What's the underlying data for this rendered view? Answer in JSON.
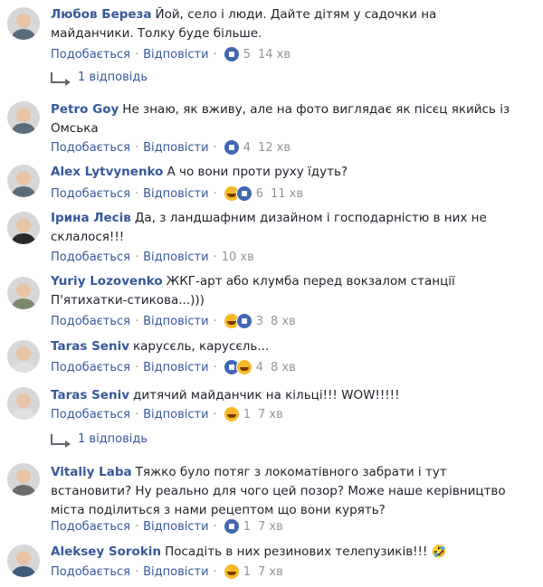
{
  "labels": {
    "like": "Подобається",
    "reply": "Відповісти",
    "separator": "·"
  },
  "comments": [
    {
      "author": "Любов Береза",
      "text": "Йой, село і люди. Дайте дітям у садочки на майданчики. Толку буде більше.",
      "reactions": [
        "like-icon"
      ],
      "count": "5",
      "time": "14 хв",
      "replies": "1 відповідь"
    },
    {
      "author": "Petro Goy",
      "text": "Не знаю, як вживу, але на фото виглядає як пісєц якийсь із Омська",
      "reactions": [
        "like-icon"
      ],
      "count": "4",
      "time": "12 хв"
    },
    {
      "author": "Alex Lytvynenko",
      "text": "А чо вони проти руху їдуть?",
      "reactions": [
        "haha-icon",
        "like-icon"
      ],
      "count": "6",
      "time": "11 хв"
    },
    {
      "author": "Ірина Лесів",
      "text": "Да, з ландшафним дизайном і господарністю в них не склалося!!!",
      "reactions": [],
      "count": "",
      "time": "10 хв"
    },
    {
      "author": "Yuriy Lozovenko",
      "text": "ЖКГ-арт або клумба перед вокзалом станції П'ятихатки-стикова...)))",
      "reactions": [
        "haha-icon",
        "like-icon"
      ],
      "count": "3",
      "time": "8 хв"
    },
    {
      "author": "Taras Seniv",
      "text": "карусєль, карусєль...",
      "reactions": [
        "like-icon",
        "haha-icon"
      ],
      "count": "4",
      "time": "8 хв"
    },
    {
      "author": "Taras Seniv",
      "text": "дитячий майданчик на кільці!!! WOW!!!!!",
      "reactions": [
        "haha-icon"
      ],
      "count": "1",
      "time": "7 хв",
      "replies": "1 відповідь"
    },
    {
      "author": "Vitaliy Laba",
      "text": "Тяжко було потяг з локоматівного забрати і тут встановити? Ну реально для чого цей позор? Може наше керівництво міста поділиться з нами рецептом що вони курять?",
      "reactions": [
        "like-icon"
      ],
      "count": "1",
      "time": "7 хв"
    },
    {
      "author": "Aleksey Sorokin",
      "text": "Посадіть в них резинових телепузиків!!! 🤣",
      "reactions": [
        "haha-icon"
      ],
      "count": "1",
      "time": "7 хв"
    }
  ]
}
